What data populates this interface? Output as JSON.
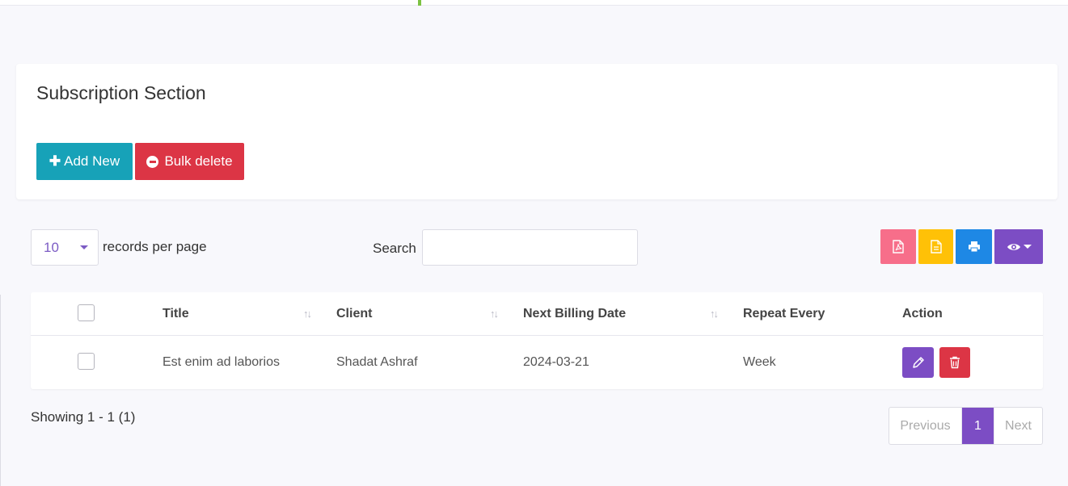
{
  "card": {
    "title": "Subscription Section",
    "add_new_label": "Add New",
    "bulk_delete_label": "Bulk delete"
  },
  "controls": {
    "per_page_value": "10",
    "per_page_label": "records per page",
    "search_label": "Search",
    "search_value": ""
  },
  "toolbar_icons": [
    "pdf-icon",
    "csv-icon",
    "print-icon",
    "eye-icon"
  ],
  "table": {
    "columns": [
      "Title",
      "Client",
      "Next Billing Date",
      "Repeat Every",
      "Action"
    ],
    "rows": [
      {
        "title": "Est enim ad laborios",
        "client": "Shadat Ashraf",
        "next_billing_date": "2024-03-21",
        "repeat_every": "Week"
      }
    ]
  },
  "footer": {
    "showing": "Showing 1 - 1 (1)",
    "prev": "Previous",
    "page": "1",
    "next": "Next"
  },
  "colors": {
    "accent": "#7c4dc4",
    "add_new": "#17a2b8",
    "bulk_delete": "#dc3545",
    "pdf": "#f76e8a",
    "csv": "#ffc107",
    "print": "#1e88e5",
    "topbar_accent": "#7cc242"
  }
}
